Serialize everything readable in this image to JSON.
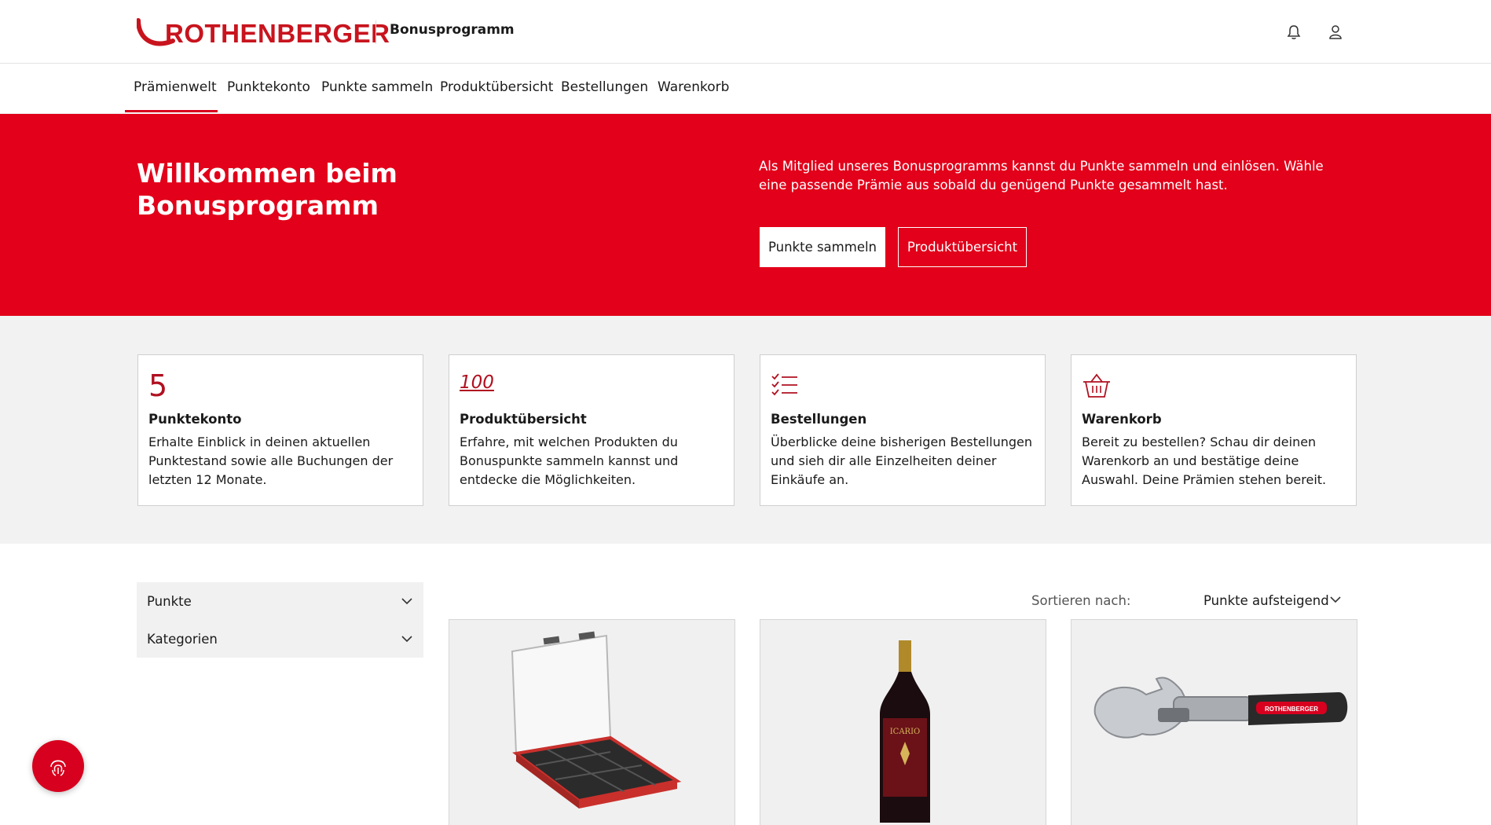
{
  "header": {
    "logo_text": "ROTHENBERGER",
    "subtitle": "Bonusprogramm",
    "icons": [
      "bell-icon",
      "user-icon"
    ]
  },
  "nav": {
    "items": [
      {
        "label": "Prämienwelt",
        "active": true
      },
      {
        "label": "Punktekonto"
      },
      {
        "label": "Punkte sammeln"
      },
      {
        "label": "Produktübersicht"
      },
      {
        "label": "Bestellungen"
      },
      {
        "label": "Warenkorb"
      }
    ]
  },
  "hero": {
    "title": "Willkommen beim Bonusprogramm",
    "text": "Als Mitglied unseres Bonusprogramms kannst du Punkte sammeln und einlösen. Wähle eine passende Prämie aus sobald du genügend Punkte gesammelt hast.",
    "primary_button": "Punkte sammeln",
    "secondary_button": "Produktübersicht"
  },
  "cards": [
    {
      "icon": "five-points-icon",
      "icon_text": "5",
      "title": "Punktekonto",
      "text": "Erhalte Einblick in deinen aktuellen Punktestand sowie alle Buchungen der letzten 12 Monate."
    },
    {
      "icon": "hundred-points-icon",
      "icon_text": "100",
      "title": "Produktübersicht",
      "text": "Erfahre, mit welchen Produkten du Bonuspunkte sammeln kannst und entdecke die Möglichkeiten."
    },
    {
      "icon": "checklist-icon",
      "title": "Bestellungen",
      "text": "Überblicke deine bisherigen Bestellungen und sieh dir alle Einzelheiten deiner Einkäufe an."
    },
    {
      "icon": "basket-icon",
      "title": "Warenkorb",
      "text": "Bereit zu bestellen? Schau dir deinen Warenkorb an und bestätige deine Auswahl. Deine Prämien stehen bereit."
    }
  ],
  "filters": [
    {
      "label": "Punkte"
    },
    {
      "label": "Kategorien"
    }
  ],
  "sort": {
    "label": "Sortieren nach:",
    "value": "Punkte aufsteigend"
  },
  "products": [
    {
      "image": "tool-case-image"
    },
    {
      "image": "wine-bottle-image",
      "label_text": "ICARIO"
    },
    {
      "image": "wrench-image",
      "label_text": "ROTHENBERGER"
    }
  ],
  "colors": {
    "brand_red": "#e2001a",
    "logo_red": "#c8141e"
  }
}
